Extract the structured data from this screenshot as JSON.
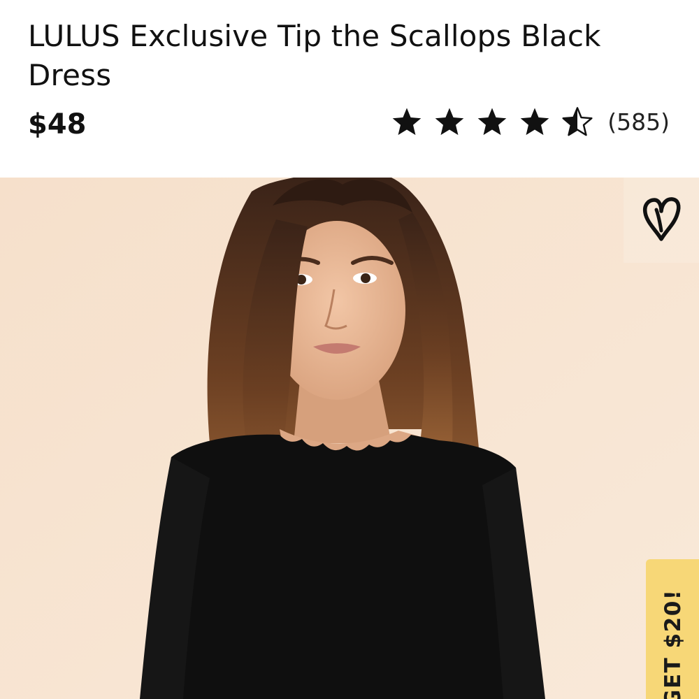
{
  "product": {
    "title": "LULUS Exclusive Tip the Scallops Black Dress",
    "price": "$48",
    "rating": {
      "value": 4.5,
      "max": 5,
      "count": "(585)"
    }
  },
  "image": {
    "alt": "Model wearing black scalloped-neckline dress"
  },
  "icons": {
    "favorite": "heart-outline-icon",
    "star_full": "star-filled-icon",
    "star_half": "star-half-icon"
  },
  "promo": {
    "label": "GET $20!"
  },
  "colors": {
    "text": "#111111",
    "hero_background": "#f7e3cf",
    "promo_background": "#f7d777",
    "dress": "#0f0f0f"
  }
}
